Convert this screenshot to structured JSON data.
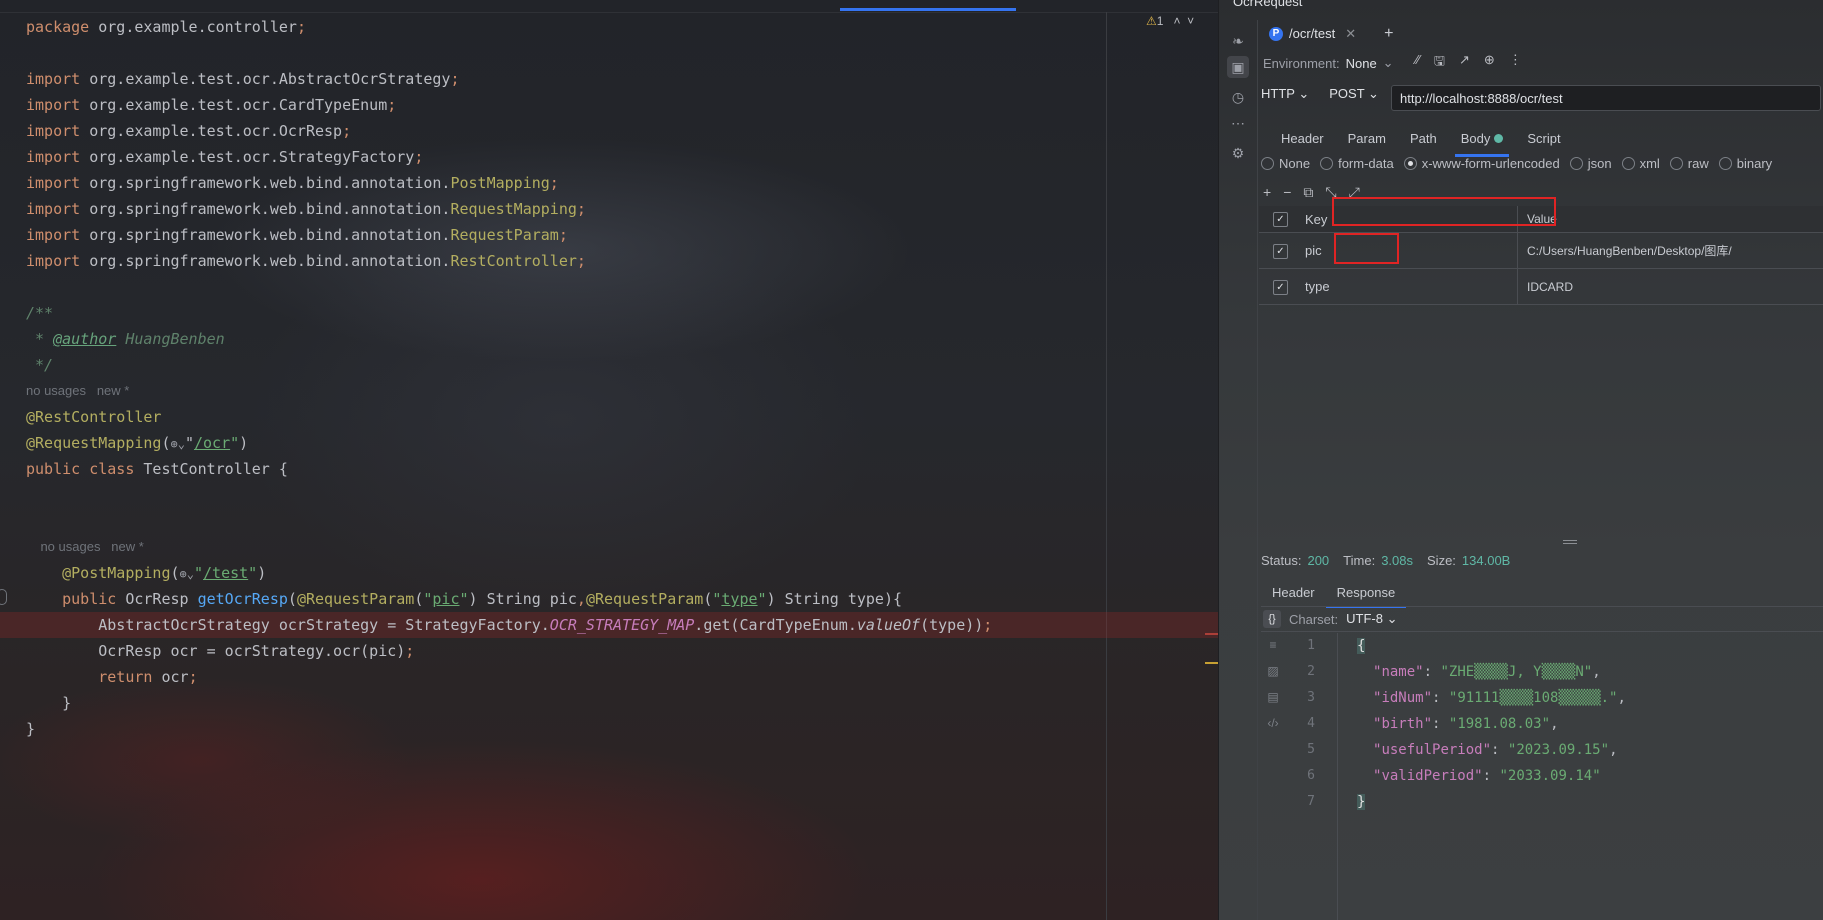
{
  "editor": {
    "warning_count": "1",
    "icons": [
      "warning-icon",
      "chevron-up-icon",
      "chevron-down-icon",
      "globe-icon"
    ],
    "lines": [
      {
        "kind": "code",
        "hl": false,
        "tokens": [
          {
            "t": "package ",
            "c": "kw"
          },
          {
            "t": "org.example.controller"
          },
          {
            "t": ";",
            "c": "kw"
          }
        ]
      },
      {
        "kind": "code",
        "hl": false,
        "tokens": []
      },
      {
        "kind": "code",
        "hl": false,
        "tokens": [
          {
            "t": "import ",
            "c": "kw"
          },
          {
            "t": "org.example.test.ocr.AbstractOcrStrategy"
          },
          {
            "t": ";",
            "c": "kw"
          }
        ]
      },
      {
        "kind": "code",
        "hl": false,
        "tokens": [
          {
            "t": "import ",
            "c": "kw"
          },
          {
            "t": "org.example.test.ocr.CardTypeEnum"
          },
          {
            "t": ";",
            "c": "kw"
          }
        ]
      },
      {
        "kind": "code",
        "hl": false,
        "tokens": [
          {
            "t": "import ",
            "c": "kw"
          },
          {
            "t": "org.example.test.ocr.OcrResp"
          },
          {
            "t": ";",
            "c": "kw"
          }
        ]
      },
      {
        "kind": "code",
        "hl": false,
        "tokens": [
          {
            "t": "import ",
            "c": "kw"
          },
          {
            "t": "org.example.test.ocr.StrategyFactory"
          },
          {
            "t": ";",
            "c": "kw"
          }
        ]
      },
      {
        "kind": "code",
        "hl": false,
        "tokens": [
          {
            "t": "import ",
            "c": "kw"
          },
          {
            "t": "org.springframework.web.bind.annotation."
          },
          {
            "t": "PostMapping",
            "c": "ann"
          },
          {
            "t": ";",
            "c": "kw"
          }
        ]
      },
      {
        "kind": "code",
        "hl": false,
        "tokens": [
          {
            "t": "import ",
            "c": "kw"
          },
          {
            "t": "org.springframework.web.bind.annotation."
          },
          {
            "t": "RequestMapping",
            "c": "ann"
          },
          {
            "t": ";",
            "c": "kw"
          }
        ]
      },
      {
        "kind": "code",
        "hl": false,
        "tokens": [
          {
            "t": "import ",
            "c": "kw"
          },
          {
            "t": "org.springframework.web.bind.annotation."
          },
          {
            "t": "RequestParam",
            "c": "ann"
          },
          {
            "t": ";",
            "c": "kw"
          }
        ]
      },
      {
        "kind": "code",
        "hl": false,
        "tokens": [
          {
            "t": "import ",
            "c": "kw"
          },
          {
            "t": "org.springframework.web.bind.annotation."
          },
          {
            "t": "RestController",
            "c": "ann"
          },
          {
            "t": ";",
            "c": "kw"
          }
        ]
      },
      {
        "kind": "code",
        "hl": false,
        "tokens": []
      },
      {
        "kind": "code",
        "hl": false,
        "tokens": [
          {
            "t": "/**",
            "c": "doc"
          }
        ]
      },
      {
        "kind": "code",
        "hl": false,
        "tokens": [
          {
            "t": " * ",
            "c": "doc"
          },
          {
            "t": "@author",
            "c": "tag"
          },
          {
            "t": " HuangBenben",
            "c": "doc"
          }
        ]
      },
      {
        "kind": "code",
        "hl": false,
        "tokens": [
          {
            "t": " */",
            "c": "doc"
          }
        ]
      },
      {
        "kind": "hint",
        "hl": false,
        "tokens": [
          {
            "t": "no usages   new *"
          }
        ]
      },
      {
        "kind": "code",
        "hl": false,
        "tokens": [
          {
            "t": "@RestController",
            "c": "ann"
          }
        ]
      },
      {
        "kind": "code",
        "hl": false,
        "tokens": [
          {
            "t": "@RequestMapping",
            "c": "ann"
          },
          {
            "t": "("
          },
          {
            "t": "⊕⌄",
            "c": "globe"
          },
          {
            "t": "\""
          },
          {
            "t": "/ocr",
            "c": "str ul"
          },
          {
            "t": "\"",
            "c": "str"
          },
          {
            "t": ")"
          }
        ]
      },
      {
        "kind": "code",
        "hl": false,
        "tokens": [
          {
            "t": "public class ",
            "c": "kw"
          },
          {
            "t": "TestController {"
          }
        ]
      },
      {
        "kind": "code",
        "hl": false,
        "tokens": []
      },
      {
        "kind": "code",
        "hl": false,
        "tokens": []
      },
      {
        "kind": "hint",
        "hl": false,
        "tokens": [
          {
            "t": "    no usages   new *"
          }
        ]
      },
      {
        "kind": "code",
        "hl": false,
        "tokens": [
          {
            "t": "    "
          },
          {
            "t": "@PostMapping",
            "c": "ann"
          },
          {
            "t": "("
          },
          {
            "t": "⊕⌄",
            "c": "globe"
          },
          {
            "t": "\"",
            "c": "str"
          },
          {
            "t": "/test",
            "c": "str ul"
          },
          {
            "t": "\"",
            "c": "str"
          },
          {
            "t": ")"
          }
        ]
      },
      {
        "kind": "code",
        "hl": false,
        "tokens": [
          {
            "t": "    "
          },
          {
            "t": "public ",
            "c": "kw"
          },
          {
            "t": "OcrResp "
          },
          {
            "t": "getOcrResp",
            "c": "pn"
          },
          {
            "t": "("
          },
          {
            "t": "@RequestParam",
            "c": "ann"
          },
          {
            "t": "("
          },
          {
            "t": "\"",
            "c": "str"
          },
          {
            "t": "pic",
            "c": "str ul"
          },
          {
            "t": "\"",
            "c": "str"
          },
          {
            "t": ") String pic"
          },
          {
            "t": ",",
            "c": "kw"
          },
          {
            "t": "@RequestParam",
            "c": "ann"
          },
          {
            "t": "("
          },
          {
            "t": "\"",
            "c": "str"
          },
          {
            "t": "type",
            "c": "str ul"
          },
          {
            "t": "\"",
            "c": "str"
          },
          {
            "t": ") String type){"
          }
        ]
      },
      {
        "kind": "code",
        "hl": true,
        "tokens": [
          {
            "t": "        AbstractOcrStrategy ocrStrategy = StrategyFactory."
          },
          {
            "t": "OCR_STRATEGY_MAP",
            "c": "it"
          },
          {
            "t": ".get(CardTypeEnum."
          },
          {
            "t": "valueOf",
            "c": "mth"
          },
          {
            "t": "(type))"
          },
          {
            "t": ";",
            "c": "kw"
          }
        ]
      },
      {
        "kind": "code",
        "hl": false,
        "tokens": [
          {
            "t": "        OcrResp ocr = ocrStrategy.ocr(pic)"
          },
          {
            "t": ";",
            "c": "kw"
          }
        ]
      },
      {
        "kind": "code",
        "hl": false,
        "tokens": [
          {
            "t": "        "
          },
          {
            "t": "return ",
            "c": "kw"
          },
          {
            "t": "ocr"
          },
          {
            "t": ";",
            "c": "kw"
          }
        ]
      },
      {
        "kind": "code",
        "hl": false,
        "tokens": [
          {
            "t": "    }"
          }
        ]
      },
      {
        "kind": "code",
        "hl": false,
        "tokens": [
          {
            "t": "}"
          }
        ]
      }
    ]
  },
  "panel": {
    "title": "OcrRequest",
    "tab_label": "/ocr/test",
    "tab_badge": "P",
    "env_label": "Environment:",
    "env_value": "None",
    "protocol": "HTTP",
    "method": "POST",
    "url": "http://localhost:8888/ocr/test",
    "subtabs": [
      "Header",
      "Param",
      "Path",
      "Body",
      "Script"
    ],
    "active_subtab": "Body",
    "body_types": [
      "None",
      "form-data",
      "x-www-form-urlencoded",
      "json",
      "xml",
      "raw",
      "binary"
    ],
    "selected_body_type": "x-www-form-urlencoded",
    "table_headers": {
      "key": "Key",
      "value": "Value"
    },
    "params": [
      {
        "key": "pic",
        "value": "C:/Users/HuangBenben/Desktop/图库/",
        "checked": true
      },
      {
        "key": "type",
        "value": "IDCARD",
        "checked": true
      }
    ],
    "status_label": "Status:",
    "status_value": "200",
    "time_label": "Time:",
    "time_value": "3.08s",
    "size_label": "Size:",
    "size_value": "134.00B",
    "resp_tabs": [
      "Header",
      "Response"
    ],
    "active_resp_tab": "Response",
    "charset_label": "Charset:",
    "charset_value": "UTF-8",
    "response_lines": [
      {
        "n": "1",
        "k": "",
        "v": "",
        "kind": "open"
      },
      {
        "n": "2",
        "k": "name",
        "v": "ZHE▒▒▒▒J, Y▒▒▒▒N",
        "kind": "pair"
      },
      {
        "n": "3",
        "k": "idNum",
        "v": "91111▒▒▒▒108▒▒▒▒▒.",
        "kind": "pair"
      },
      {
        "n": "4",
        "k": "birth",
        "v": "1981.08.03",
        "kind": "pair"
      },
      {
        "n": "5",
        "k": "usefulPeriod",
        "v": "2023.09.15",
        "kind": "pair"
      },
      {
        "n": "6",
        "k": "validPeriod",
        "v": "2033.09.14",
        "kind": "last"
      },
      {
        "n": "7",
        "k": "",
        "v": "",
        "kind": "close"
      }
    ],
    "icons": [
      "request-icon",
      "history-icon",
      "more-icon",
      "settings-icon",
      "wrap-icon",
      "image-icon",
      "doc-icon",
      "code-icon",
      "add-row-icon",
      "remove-row-icon",
      "copy-icon",
      "import-icon",
      "export-icon",
      "save-icon",
      "share-icon",
      "target-icon",
      "kebab-icon"
    ]
  }
}
